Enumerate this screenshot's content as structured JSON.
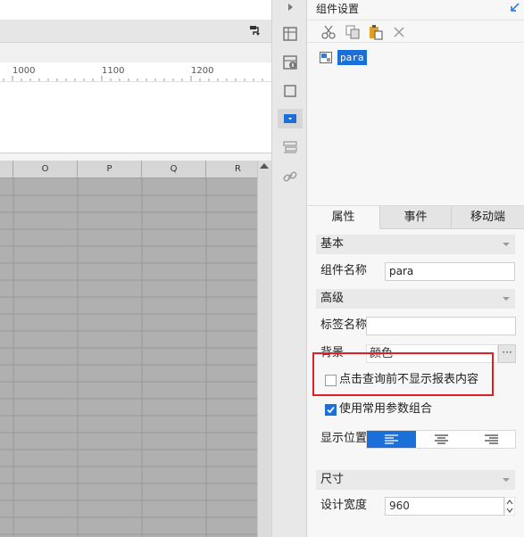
{
  "canvas": {
    "ruler_labels": [
      "1000",
      "1100",
      "1200"
    ],
    "columns": [
      "O",
      "P",
      "Q",
      "R"
    ]
  },
  "panel": {
    "title": "组件设置",
    "tree_item": "para",
    "tabs": [
      "属性",
      "事件",
      "移动端"
    ],
    "sections": {
      "basic": "基本",
      "advanced": "高级",
      "size": "尺寸"
    },
    "component_name": {
      "label": "组件名称",
      "value": "para"
    },
    "tag_name": {
      "label": "标签名称",
      "value": ""
    },
    "background": {
      "label": "背景",
      "value": "颜色",
      "more": "···"
    },
    "hide_before_query": {
      "label": "点击查询前不显示报表内容",
      "checked": false
    },
    "common_param_combo": {
      "label": "使用常用参数组合",
      "checked": true
    },
    "display_position": {
      "label": "显示位置",
      "selected": "left"
    },
    "design_width": {
      "label": "设计宽度",
      "value": "960"
    }
  },
  "colors": {
    "accent": "#1a6fd8",
    "highlight": "#e02020"
  }
}
